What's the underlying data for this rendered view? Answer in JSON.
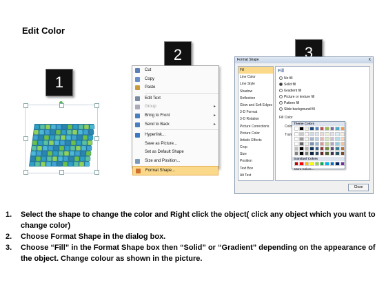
{
  "title": "Edit Color",
  "badges": [
    "1",
    "2",
    "3"
  ],
  "context_menu": {
    "items": [
      {
        "label": "Cut",
        "icon": "scissors-icon",
        "enabled": true
      },
      {
        "label": "Copy",
        "icon": "copy-icon",
        "enabled": true
      },
      {
        "label": "Paste",
        "icon": "paste-icon",
        "enabled": true
      },
      {
        "label": "Edit Text",
        "icon": "edit-text-icon",
        "enabled": true
      },
      {
        "label": "Group",
        "icon": "group-icon",
        "enabled": false,
        "submenu": true
      },
      {
        "label": "Bring to Front",
        "icon": "bring-front-icon",
        "enabled": true,
        "submenu": true
      },
      {
        "label": "Send to Back",
        "icon": "send-back-icon",
        "enabled": true,
        "submenu": true
      },
      {
        "label": "Hyperlink...",
        "icon": "hyperlink-icon",
        "enabled": true
      },
      {
        "label": "Save as Picture...",
        "icon": "",
        "enabled": true
      },
      {
        "label": "Set as Default Shape",
        "icon": "",
        "enabled": true
      },
      {
        "label": "Size and Position...",
        "icon": "size-icon",
        "enabled": true
      },
      {
        "label": "Format Shape...",
        "icon": "format-shape-icon",
        "enabled": true,
        "highlighted": true
      }
    ]
  },
  "dialog": {
    "title": "Format Shape",
    "close_x": "X",
    "categories": [
      "Fill",
      "Line Color",
      "Line Style",
      "Shadow",
      "Reflection",
      "Glow and Soft Edges",
      "3-D Format",
      "3-D Rotation",
      "Picture Corrections",
      "Picture Color",
      "Artistic Effects",
      "Crop",
      "Size",
      "Position",
      "Text Box",
      "Alt Text"
    ],
    "section_header": "Fill",
    "options": [
      "No fill",
      "Solid fill",
      "Gradient fill",
      "Picture or texture fill",
      "Pattern fill",
      "Slide background fill"
    ],
    "selected_option": 1,
    "fill_color_label": "Fill Color",
    "color_label": "Color:",
    "transparency_label": "Transp",
    "close_button": "Close"
  },
  "palette": {
    "theme_header": "Theme Colors",
    "standard_header": "Standard Colors",
    "more": "More Colors...",
    "theme_colors": [
      "#ffffff",
      "#000000",
      "#eeece1",
      "#1f497d",
      "#4f81bd",
      "#c0504d",
      "#9bbb59",
      "#8064a2",
      "#4bacc6",
      "#f79646"
    ],
    "standard_colors": [
      "#c00000",
      "#ff0000",
      "#ffc000",
      "#ffff00",
      "#92d050",
      "#00b050",
      "#00b0f0",
      "#0070c0",
      "#002060",
      "#7030a0"
    ]
  },
  "instructions": [
    {
      "num": "1.",
      "text": "Select the shape to change the color and Right click the object( click any object which you want to change color)"
    },
    {
      "num": "2.",
      "text": "Choose Format Shape in the dialog box."
    },
    {
      "num": "3.",
      "text": "Choose “Fill” in the Format Shape box then “Solid” or “Gradient” depending on the appearance of the object. Change colour as shown in the picture."
    }
  ]
}
